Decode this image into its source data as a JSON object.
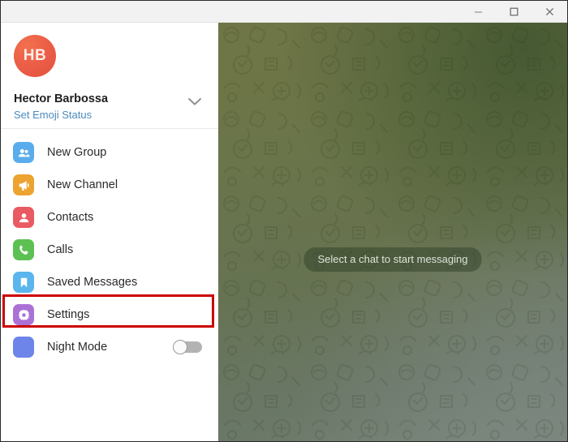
{
  "window": {
    "titlebar": {
      "minimize_label": "Minimize",
      "minimize_icon": "minimize-icon",
      "maximize_label": "Maximize",
      "maximize_icon": "maximize-icon",
      "close_label": "Close",
      "close_icon": "close-icon"
    }
  },
  "sidebar": {
    "profile": {
      "initials": "HB",
      "name": "Hector Barbossa",
      "status_label": "Set Emoji Status",
      "status_color": "#4b8bbd",
      "expand_icon": "chevron-down-icon",
      "avatar_color": "#ec5f47"
    },
    "menu": [
      {
        "label": "New Group",
        "icon": "new-group-icon",
        "color": "#5aadec",
        "key": "new-group"
      },
      {
        "label": "New Channel",
        "icon": "megaphone-icon",
        "color": "#eca32f",
        "key": "new-channel"
      },
      {
        "label": "Contacts",
        "icon": "contacts-icon",
        "color": "#ea5a62",
        "key": "contacts"
      },
      {
        "label": "Calls",
        "icon": "phone-icon",
        "color": "#5cc152",
        "key": "calls"
      },
      {
        "label": "Saved Messages",
        "icon": "bookmark-icon",
        "color": "#5ab6ec",
        "key": "saved-messages"
      },
      {
        "label": "Settings",
        "icon": "gear-icon",
        "color": "#ab72d6",
        "key": "settings"
      },
      {
        "label": "Night Mode",
        "icon": "moon-icon",
        "color": "#6d84e8",
        "key": "night-mode"
      }
    ],
    "night_mode": {
      "state": "off",
      "toggle_name": "night-mode-toggle"
    },
    "highlight": {
      "target": "settings",
      "color": "#cc0000"
    }
  },
  "chat": {
    "empty_state_text": "Select a chat to start messaging",
    "background_colors": [
      "#6f7546",
      "#67724c",
      "#808a82"
    ]
  }
}
